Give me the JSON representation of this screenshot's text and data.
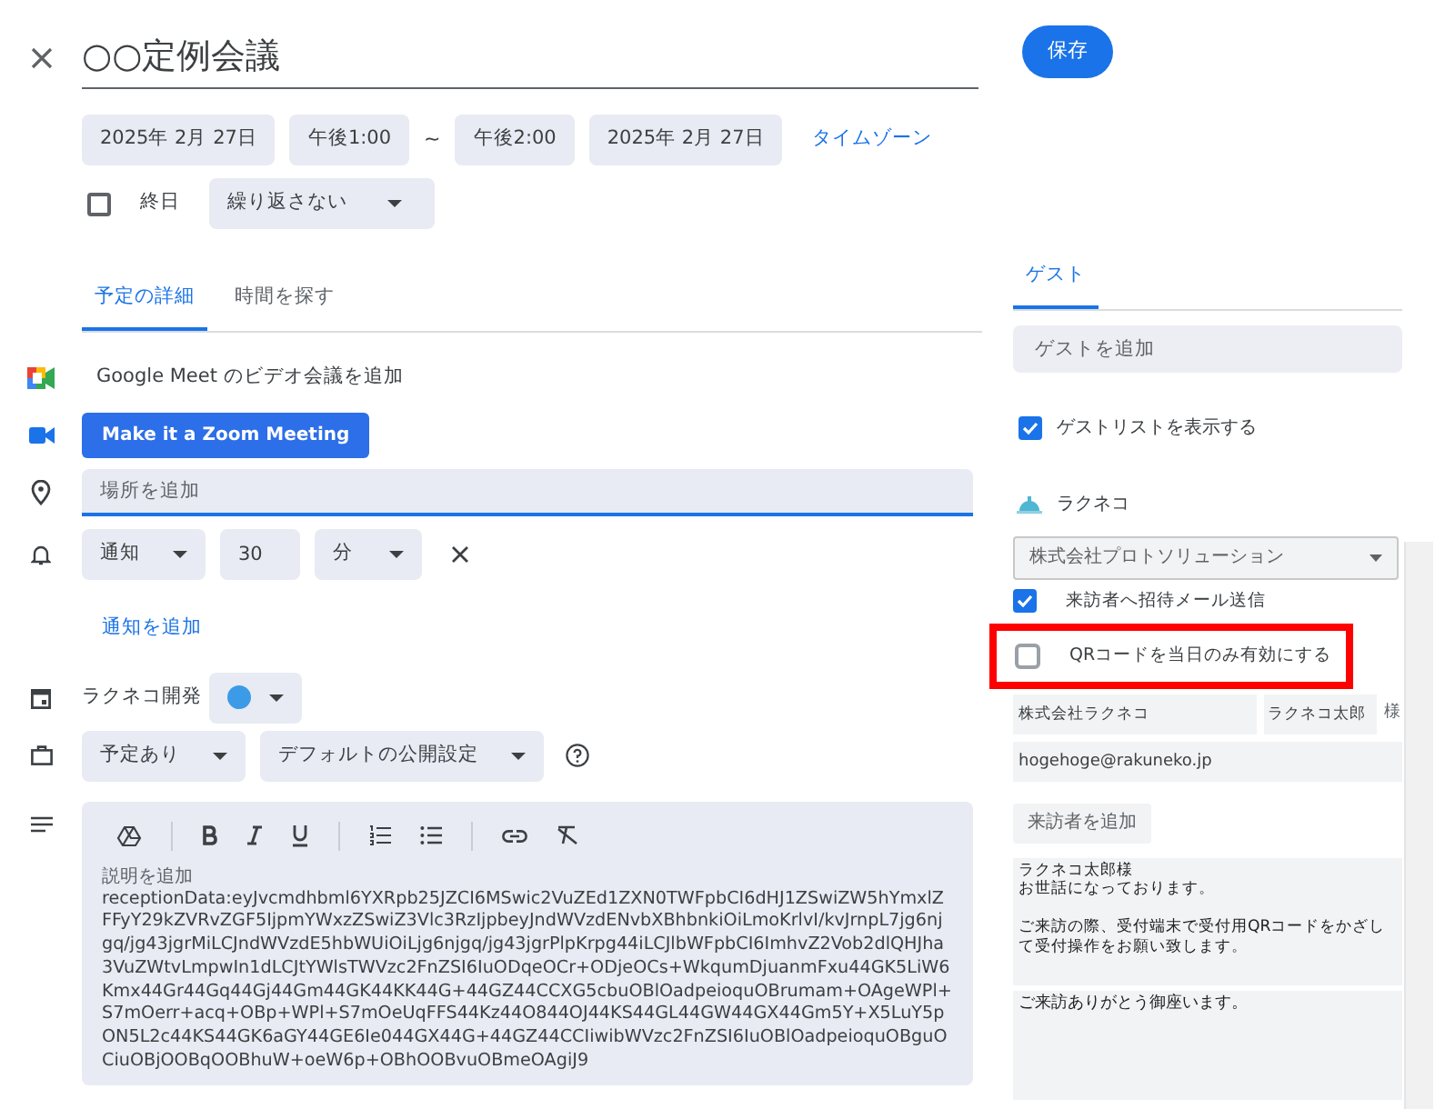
{
  "title": "○○定例会議",
  "save_button": "保存",
  "datetime": {
    "start_date": "2025年 2月 27日",
    "start_time": "午後1:00",
    "separator": "~",
    "end_time": "午後2:00",
    "end_date": "2025年 2月 27日",
    "timezone_link": "タイムゾーン"
  },
  "all_day": {
    "label": "終日",
    "checked": false
  },
  "repeat": "繰り返さない",
  "tabs": [
    {
      "label": "予定の詳細",
      "selected": true
    },
    {
      "label": "時間を探す",
      "selected": false
    }
  ],
  "meet_link": "Google Meet のビデオ会議を追加",
  "zoom_button": "Make it a Zoom Meeting",
  "location": {
    "placeholder": "場所を追加"
  },
  "notification": {
    "type": "通知",
    "value": "30",
    "unit": "分"
  },
  "add_notification": "通知を追加",
  "calendar": {
    "name": "ラクネコ開発",
    "color": "#3b9be6"
  },
  "availability": "予定あり",
  "visibility": "デフォルトの公開設定",
  "description": {
    "placeholder": "説明を追加",
    "text": "receptionData:eyJvcmdhbml6YXRpb25JZCI6MSwic2VuZEd1ZXN0TWFpbCI6dHJ1ZSwiZW5hYmxlZFFyY29kZVRvZGF5IjpmYWxzZSwiZ3Vlc3RzIjpbeyJndWVzdENvbXBhbnkiOiLmoKrlvI/kvJrnpL7jg6njgq/jg43jgrMiLCJndWVzdE5hbWUiOiLjg6njgq/jg43jgrPlpKrpg44iLCJlbWFpbCI6ImhvZ2Vob2dlQHJha3VuZWtvLmpwIn1dLCJtYWlsTWVzc2FnZSI6IuODqeOCr+ODjeOCs+WkqumDjuanmFxu44GK5LiW6Kmx44Gr44Gq44Gj44Gm44GK44KK44G+44GZ44CCXG5cbuOBlOadpeioquOBrumam+OAgeWPl+S7mOerr+acq+OBp+WPl+S7mOeUqFFS44Kz44O844OJ44KS44GL44GW44GX44Gm5Y+X5LuY5pON5L2c44KS44GK6aGY44GE6Ie044GX44G+44GZ44CCIiwibWVzc2FnZSI6IuOBlOadpeioquOBguOCiuOBjOOBqOOBhuW+oeW6p+OBhOOBvuOBmeOAgiJ9"
  },
  "guests": {
    "tab": {
      "label": "ゲスト",
      "selected": true
    },
    "placeholder": "ゲストを追加",
    "show_list": {
      "label": "ゲストリストを表示する",
      "checked": true
    }
  },
  "addon": {
    "name": "ラクネコ",
    "organization": "株式会社プロトソリューション",
    "options": [
      {
        "label": "来訪者へ招待メール送信",
        "checked": true,
        "highlighted": false
      },
      {
        "label": "QRコードを当日のみ有効にする",
        "checked": false,
        "highlighted": true
      }
    ],
    "visitor": {
      "company": "株式会社ラクネコ",
      "name": "ラクネコ太郎",
      "suffix": "様",
      "email": "hogehoge@rakuneko.jp"
    },
    "add_visitor": "来訪者を追加",
    "mail_message": [
      {
        "text": "ラクネコ太郎様",
        "gap_before": false
      },
      {
        "text": "お世話になっております。",
        "gap_before": false
      },
      {
        "text": "ご来訪の際、受付端末で受付用QRコードをかざして受付操作をお願い致します。",
        "gap_before": true
      }
    ],
    "message": "ご来訪ありがとう御座います。"
  }
}
